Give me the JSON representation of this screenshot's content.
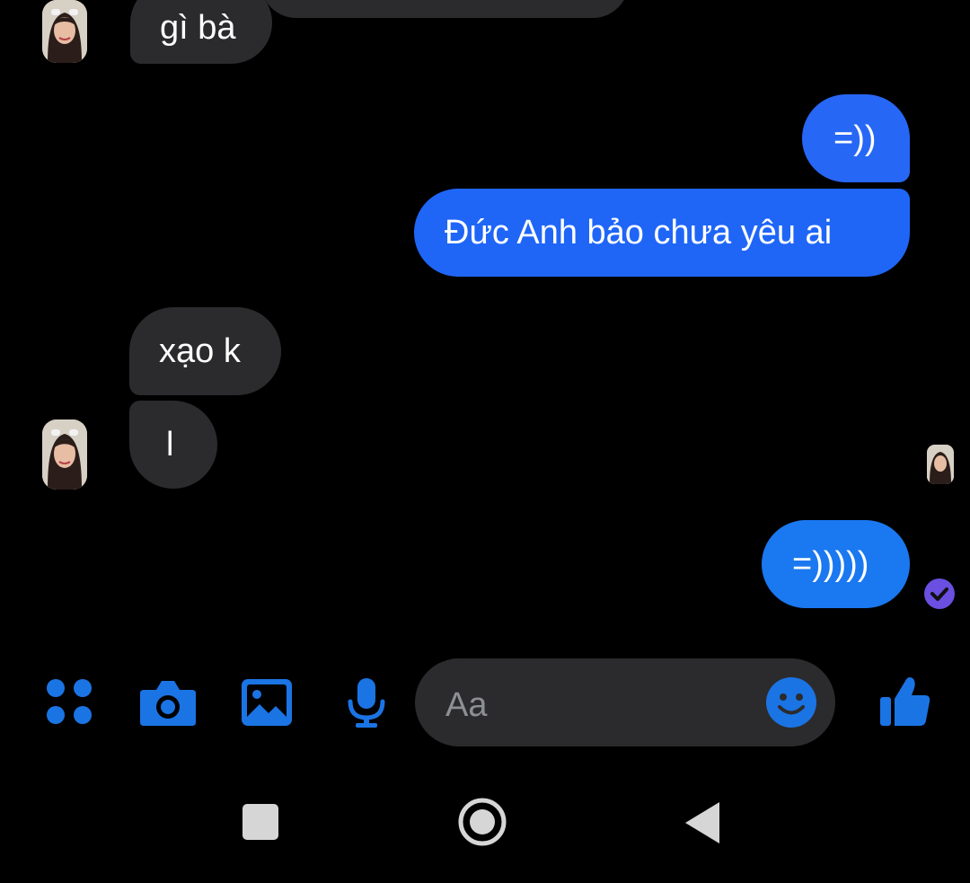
{
  "colors": {
    "background": "#000000",
    "incoming_bubble": "#2b2b2d",
    "outgoing_bubble": "#1f66ff",
    "accent_blue": "#1b74e4",
    "read_receipt": "#6a4fe0",
    "nav_gray": "#d6d6d6"
  },
  "messages": [
    {
      "direction": "incoming",
      "text": "gì bà"
    },
    {
      "direction": "outgoing",
      "text": "=))"
    },
    {
      "direction": "outgoing",
      "text": "Đức Anh bảo chưa yêu ai"
    },
    {
      "direction": "incoming",
      "text": "xạo k"
    },
    {
      "direction": "incoming",
      "text": "l"
    },
    {
      "direction": "outgoing",
      "text": "=)))))"
    }
  ],
  "composer": {
    "placeholder": "Aa",
    "icons": [
      "menu-dots-icon",
      "camera-icon",
      "image-icon",
      "microphone-icon",
      "emoji-icon",
      "thumbs-up-icon"
    ]
  },
  "status": {
    "read_receipt_icon": "check-circle-icon",
    "seen_avatar": "contact-avatar"
  },
  "nav_bar": {
    "icons": [
      "recent-apps-icon",
      "home-icon",
      "back-icon"
    ]
  }
}
